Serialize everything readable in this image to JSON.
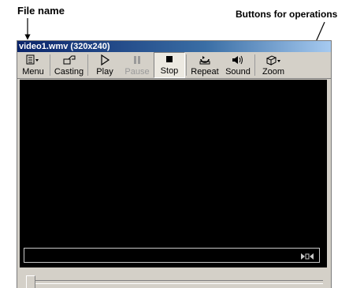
{
  "annotations": {
    "file_name": "File name",
    "buttons": "Buttons for operations"
  },
  "window": {
    "title": "video1.wmv (320x240)"
  },
  "toolbar": {
    "buttons": [
      {
        "label": "Menu",
        "icon": "menu-icon"
      },
      {
        "label": "Casting",
        "icon": "casting-icon"
      },
      {
        "label": "Play",
        "icon": "play-icon"
      },
      {
        "label": "Pause",
        "icon": "pause-icon",
        "disabled": true
      },
      {
        "label": "Stop",
        "icon": "stop-icon",
        "pressed": true
      },
      {
        "label": "Repeat",
        "icon": "repeat-icon"
      },
      {
        "label": "Sound",
        "icon": "sound-icon"
      },
      {
        "label": "Zoom",
        "icon": "zoom-icon"
      }
    ]
  },
  "colors": {
    "titlebar": "#0a246a",
    "video_background": "#000000",
    "toolbar_background": "#d4d0c8"
  }
}
